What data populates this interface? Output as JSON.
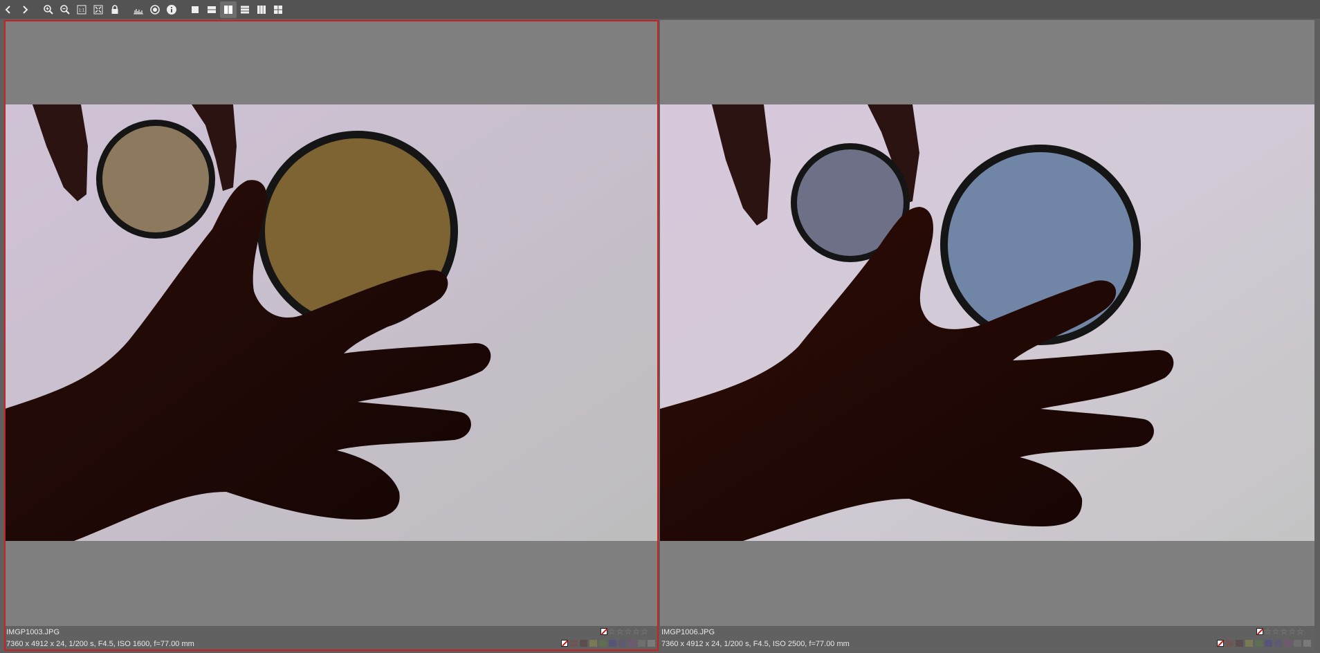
{
  "toolbar": {
    "buttons": [
      {
        "name": "prev-image-button",
        "icon": "chevron-left-icon"
      },
      {
        "name": "next-image-button",
        "icon": "chevron-right-icon"
      },
      {
        "name": "zoom-in-button",
        "icon": "zoom-in-icon"
      },
      {
        "name": "zoom-out-button",
        "icon": "zoom-out-icon"
      },
      {
        "name": "zoom-100-button",
        "icon": "one-to-one-icon"
      },
      {
        "name": "zoom-fit-button",
        "icon": "fit-icon"
      },
      {
        "name": "lock-button",
        "icon": "lock-icon"
      },
      {
        "name": "histogram-button",
        "icon": "histogram-icon"
      },
      {
        "name": "focus-button",
        "icon": "aperture-icon"
      },
      {
        "name": "info-button",
        "icon": "info-icon"
      },
      {
        "name": "layout-single-button",
        "icon": "layout-single-icon"
      },
      {
        "name": "layout-two-rows-button",
        "icon": "layout-rows-icon"
      },
      {
        "name": "layout-two-cols-button",
        "icon": "layout-cols-icon",
        "active": true
      },
      {
        "name": "layout-three-rows-button",
        "icon": "layout-three-rows-icon"
      },
      {
        "name": "layout-three-cols-button",
        "icon": "layout-three-cols-icon"
      },
      {
        "name": "layout-grid-button",
        "icon": "layout-grid-icon"
      }
    ]
  },
  "images": [
    {
      "filename": "IMGP1003.JPG",
      "exif": "7360 x 4912 x 24, 1/200 s, F4.5, ISO 1600, f=77.00 mm",
      "selected": true,
      "stars": 5,
      "filter_small": "#8d7a5e",
      "filter_large": "#7d6432"
    },
    {
      "filename": "IMGP1006.JPG",
      "exif": "7360 x 4912 x 24, 1/200 s, F4.5, ISO 2500, f=77.00 mm",
      "selected": false,
      "stars": 5,
      "filter_small": "#6e7088",
      "filter_large": "#7186a6"
    }
  ],
  "color_labels": [
    "#6e5656",
    "#5b4e4e",
    "#7a7a52",
    "#5e6e52",
    "#55557a",
    "#5e5a72",
    "#6e5a6e",
    "#6e6e6e",
    "#7a7a7a",
    "#4a4a4a"
  ],
  "colors": {
    "selection_border": "#cc1f1f",
    "pane_bg": "#7f7f7f",
    "toolbar_bg": "#535353"
  }
}
